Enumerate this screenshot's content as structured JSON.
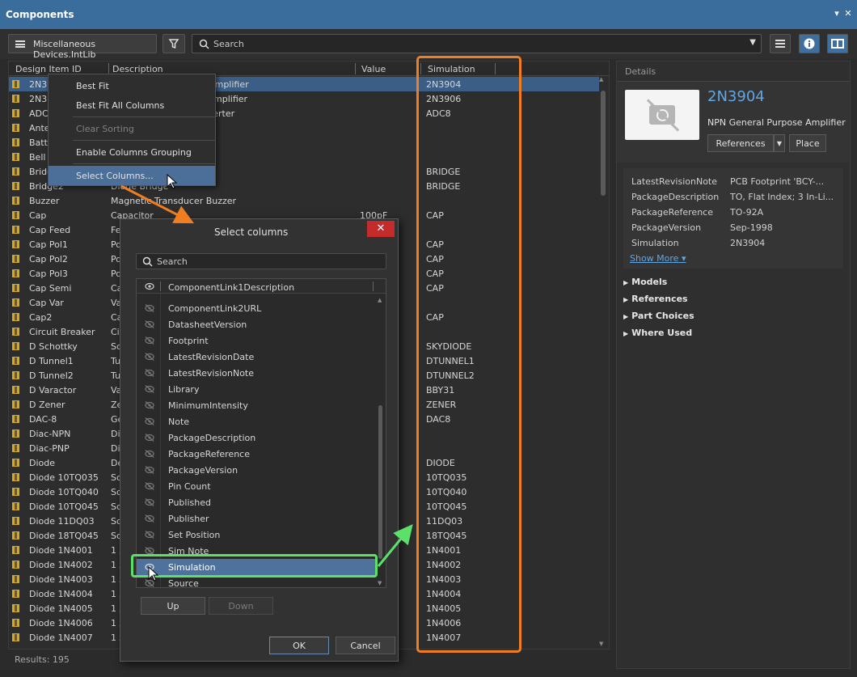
{
  "window": {
    "title": "Components"
  },
  "toolbar": {
    "library_label": "Miscellaneous Devices.IntLib",
    "search_placeholder": "Search"
  },
  "table": {
    "columns": [
      "Design Item ID",
      "Description",
      "Value",
      "Simulation"
    ],
    "rows": [
      {
        "id": "2N3904",
        "desc": "NPN General Purpose Amplifier",
        "value": "",
        "sim": "2N3904",
        "selected": true
      },
      {
        "id": "2N3906",
        "desc": "PNP General Purpose Amplifier",
        "value": "",
        "sim": "2N3906"
      },
      {
        "id": "ADC-8",
        "desc": "Generic 8-Bit A/D Converter",
        "value": "",
        "sim": "ADC8"
      },
      {
        "id": "Antenna",
        "desc": "",
        "value": "",
        "sim": ""
      },
      {
        "id": "Battery",
        "desc": "",
        "value": "",
        "sim": ""
      },
      {
        "id": "Bell",
        "desc": "",
        "value": "",
        "sim": ""
      },
      {
        "id": "Bridge1",
        "desc": "",
        "value": "",
        "sim": "BRIDGE"
      },
      {
        "id": "Bridge2",
        "desc": "Diode Bridge",
        "value": "",
        "sim": "BRIDGE"
      },
      {
        "id": "Buzzer",
        "desc": "Magnetic Transducer Buzzer",
        "value": "",
        "sim": ""
      },
      {
        "id": "Cap",
        "desc": "Capacitor",
        "value": "100pF",
        "sim": "CAP"
      },
      {
        "id": "Cap Feed",
        "desc": "Fe",
        "value": "",
        "sim": ""
      },
      {
        "id": "Cap Pol1",
        "desc": "Po",
        "value": "",
        "sim": "CAP"
      },
      {
        "id": "Cap Pol2",
        "desc": "Po",
        "value": "",
        "sim": "CAP"
      },
      {
        "id": "Cap Pol3",
        "desc": "Po",
        "value": "",
        "sim": "CAP"
      },
      {
        "id": "Cap Semi",
        "desc": "Ca",
        "value": "",
        "sim": "CAP"
      },
      {
        "id": "Cap Var",
        "desc": "Va",
        "value": "",
        "sim": ""
      },
      {
        "id": "Cap2",
        "desc": "Ca",
        "value": "",
        "sim": "CAP"
      },
      {
        "id": "Circuit Breaker",
        "desc": "Ci",
        "value": "",
        "sim": ""
      },
      {
        "id": "D Schottky",
        "desc": "Sc",
        "value": "",
        "sim": "SKYDIODE"
      },
      {
        "id": "D Tunnel1",
        "desc": "Tu",
        "value": "",
        "sim": "DTUNNEL1"
      },
      {
        "id": "D Tunnel2",
        "desc": "Tu",
        "value": "",
        "sim": "DTUNNEL2"
      },
      {
        "id": "D Varactor",
        "desc": "Va",
        "value": "",
        "sim": "BBY31"
      },
      {
        "id": "D Zener",
        "desc": "Ze",
        "value": "",
        "sim": "ZENER"
      },
      {
        "id": "DAC-8",
        "desc": "Ge",
        "value": "",
        "sim": "DAC8"
      },
      {
        "id": "Diac-NPN",
        "desc": "Di",
        "value": "",
        "sim": ""
      },
      {
        "id": "Diac-PNP",
        "desc": "Di",
        "value": "",
        "sim": ""
      },
      {
        "id": "Diode",
        "desc": "De",
        "value": "",
        "sim": "DIODE"
      },
      {
        "id": "Diode 10TQ035",
        "desc": "Sc",
        "value": "",
        "sim": "10TQ035"
      },
      {
        "id": "Diode 10TQ040",
        "desc": "Sc",
        "value": "",
        "sim": "10TQ040"
      },
      {
        "id": "Diode 10TQ045",
        "desc": "Sc",
        "value": "",
        "sim": "10TQ045"
      },
      {
        "id": "Diode 11DQ03",
        "desc": "Sc",
        "value": "",
        "sim": "11DQ03"
      },
      {
        "id": "Diode 18TQ045",
        "desc": "Sc",
        "value": "",
        "sim": "18TQ045"
      },
      {
        "id": "Diode 1N4001",
        "desc": "1 A",
        "value": "",
        "sim": "1N4001"
      },
      {
        "id": "Diode 1N4002",
        "desc": "1 A",
        "value": "",
        "sim": "1N4002"
      },
      {
        "id": "Diode 1N4003",
        "desc": "1 A",
        "value": "",
        "sim": "1N4003"
      },
      {
        "id": "Diode 1N4004",
        "desc": "1 A",
        "value": "",
        "sim": "1N4004"
      },
      {
        "id": "Diode 1N4005",
        "desc": "1 A",
        "value": "",
        "sim": "1N4005"
      },
      {
        "id": "Diode 1N4006",
        "desc": "1 A",
        "value": "",
        "sim": "1N4006"
      },
      {
        "id": "Diode 1N4007",
        "desc": "1 A",
        "value": "",
        "sim": "1N4007"
      }
    ]
  },
  "status": {
    "results": "Results: 195"
  },
  "context_menu": {
    "items": [
      "Best Fit",
      "Best Fit All Columns",
      "Clear Sorting",
      "Enable Columns Grouping",
      "Select Columns..."
    ]
  },
  "dialog": {
    "title": "Select columns",
    "search_placeholder": "Search",
    "partial_item": "ComponentLink1Description",
    "items": [
      {
        "label": "ComponentLink2URL",
        "visible": false
      },
      {
        "label": "DatasheetVersion",
        "visible": false
      },
      {
        "label": "Footprint",
        "visible": false
      },
      {
        "label": "LatestRevisionDate",
        "visible": false
      },
      {
        "label": "LatestRevisionNote",
        "visible": false
      },
      {
        "label": "Library",
        "visible": false
      },
      {
        "label": "MinimumIntensity",
        "visible": false
      },
      {
        "label": "Note",
        "visible": false
      },
      {
        "label": "PackageDescription",
        "visible": false
      },
      {
        "label": "PackageReference",
        "visible": false
      },
      {
        "label": "PackageVersion",
        "visible": false
      },
      {
        "label": "Pin Count",
        "visible": false
      },
      {
        "label": "Published",
        "visible": false
      },
      {
        "label": "Publisher",
        "visible": false
      },
      {
        "label": "Set Position",
        "visible": false
      },
      {
        "label": "Sim Note",
        "visible": false
      },
      {
        "label": "Simulation",
        "visible": true,
        "selected": true
      },
      {
        "label": "Source",
        "visible": false
      }
    ],
    "up_label": "Up",
    "down_label": "Down",
    "ok_label": "OK",
    "cancel_label": "Cancel"
  },
  "details": {
    "header": "Details",
    "name": "2N3904",
    "description": "NPN General Purpose Amplifier",
    "references_label": "References",
    "place_label": "Place",
    "params": [
      {
        "key": "LatestRevisionNote",
        "value": "PCB Footprint 'BCY-..."
      },
      {
        "key": "PackageDescription",
        "value": "TO, Flat Index; 3 In-Li..."
      },
      {
        "key": "PackageReference",
        "value": "TO-92A"
      },
      {
        "key": "PackageVersion",
        "value": "Sep-1998"
      },
      {
        "key": "Simulation",
        "value": "2N3904"
      }
    ],
    "show_more": "Show More",
    "sections": [
      "Models",
      "References",
      "Part Choices",
      "Where Used"
    ]
  },
  "colors": {
    "accent": "#3b6d9c",
    "highlight_orange": "#ef7d22",
    "highlight_green": "#5be06a",
    "link": "#5ea7e8"
  }
}
